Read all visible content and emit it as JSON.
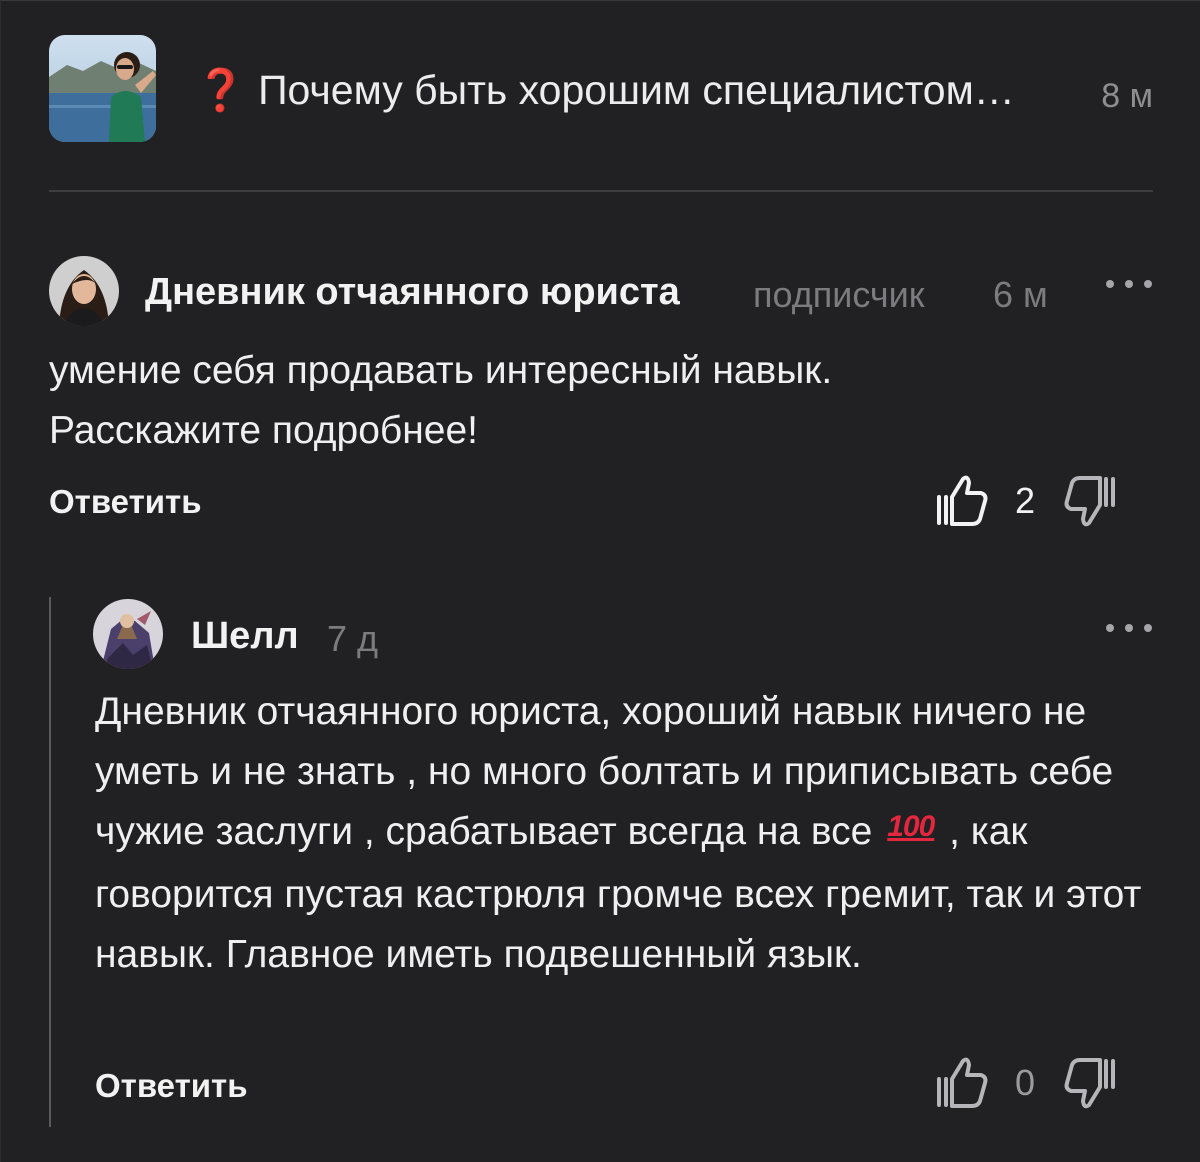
{
  "post": {
    "question_icon": "❓",
    "title": "Почему быть хорошим специалистом…",
    "time": "8 м"
  },
  "comments": [
    {
      "author": "Дневник отчаянного юриста",
      "badge": "подписчик",
      "time": "6 м",
      "text": "умение себя продавать интересный навык. Расскажите подробнее!",
      "reply_label": "Ответить",
      "likes": "2"
    },
    {
      "author": "Шелл",
      "time": "7 д",
      "text_before_emoji": "Дневник отчаянного юриста, хороший навык ничего не уметь и не знать , но много болтать и приписывать себе чужие заслуги , срабатывает всегда на все ",
      "emoji": "100",
      "text_after_emoji": " , как говорится пустая кастрюля громче всех гремит, так и этот навык. Главное иметь подвешенный язык.",
      "reply_label": "Ответить",
      "likes": "0"
    }
  ],
  "icons": {
    "like": "thumbs-up-icon",
    "dislike": "thumbs-down-icon",
    "more": "more-dots-icon"
  },
  "colors": {
    "background": "#212123",
    "accent_question": "#e1342b",
    "muted_text": "#7c7c80",
    "emoji_red": "#e5263f"
  }
}
